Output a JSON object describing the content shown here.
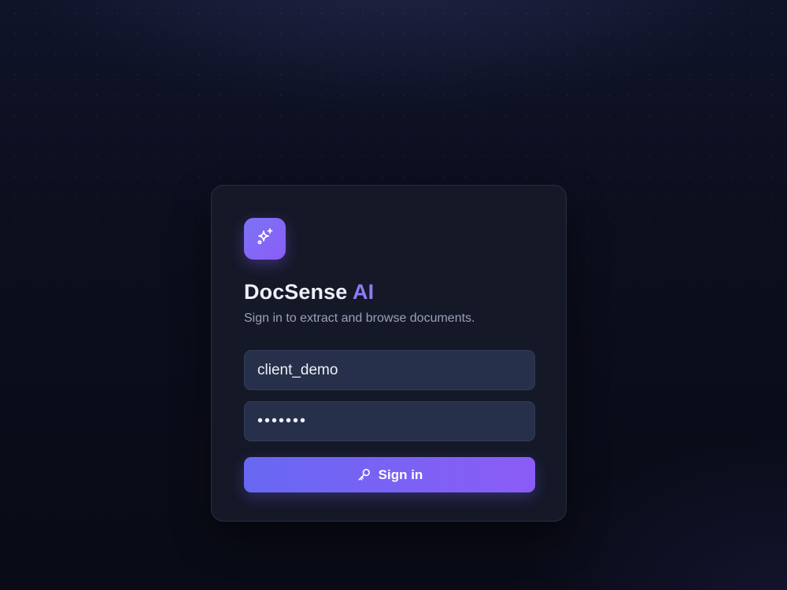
{
  "app": {
    "name": "DocSense",
    "name_accent": "AI",
    "subtitle": "Sign in to extract and browse documents.",
    "logo_icon": "sparkles-icon"
  },
  "form": {
    "username_value": "client_demo",
    "password_value": "demo123",
    "signin_label": "Sign in",
    "signin_icon": "key-icon"
  },
  "colors": {
    "accent": "#8b5cf6",
    "button_gradient_start": "#6868f3",
    "card_background": "#151827",
    "input_background": "#27304a"
  }
}
